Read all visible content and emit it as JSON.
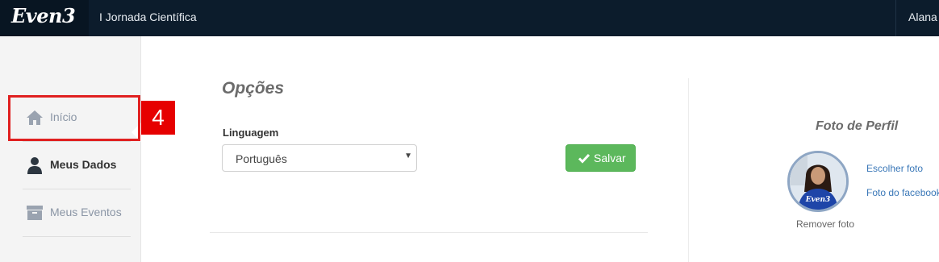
{
  "header": {
    "logo_text": "Even3",
    "event_name": "I Jornada Científica",
    "user_name": "Alana Oliveira"
  },
  "sidebar": {
    "items": [
      {
        "label": "Início",
        "icon": "home-icon"
      },
      {
        "label": "Meus Dados",
        "icon": "user-icon",
        "active": true
      },
      {
        "label": "Meus Eventos",
        "icon": "archive-box-icon"
      }
    ]
  },
  "annotation": {
    "step_number": "4",
    "color": "#e60000"
  },
  "main": {
    "title": "Opções",
    "language_label": "Linguagem",
    "language_value": "Português",
    "save_label": "Salvar"
  },
  "profile": {
    "title": "Foto de Perfil",
    "choose_photo": "Escolher foto",
    "facebook_photo": "Foto do facebook",
    "remove_photo": "Remover foto",
    "shirt_text": "Even3"
  },
  "colors": {
    "topbar": "#0c1c2c",
    "save_button": "#5cb85c",
    "link": "#3b78b8"
  }
}
